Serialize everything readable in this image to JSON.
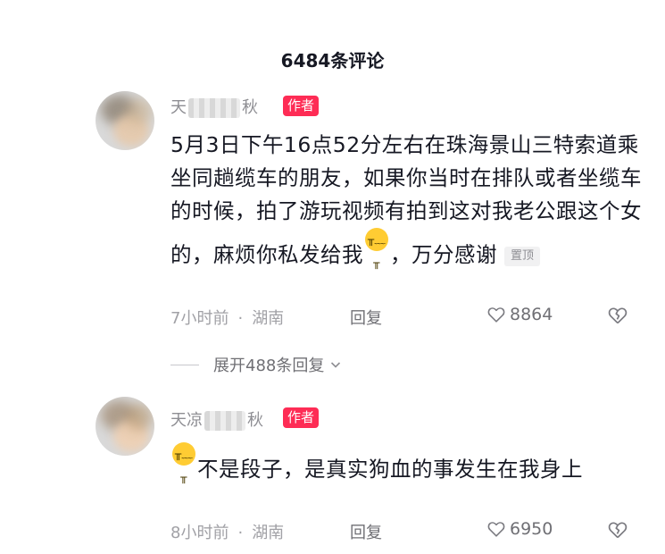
{
  "header": {
    "title": "6484条评论"
  },
  "comments": [
    {
      "username_visible": "天",
      "username_tail": "秋",
      "author_tag": "作者",
      "text_before_emoji": "5月3日下午16点52分左右在珠海景山三特索道乘坐同趟缆车的朋友，如果你当时在排队或者坐缆车的时候，拍了游玩视频有拍到这对我老公跟这个女的，麻烦你私发给我",
      "text_after_emoji": "，万分感谢",
      "pin_tag": "置顶",
      "time": "7小时前",
      "location": "湖南",
      "reply": "回复",
      "likes": "8864"
    },
    {
      "username_visible": "天凉",
      "username_tail": "秋",
      "author_tag": "作者",
      "text_before_emoji": "",
      "text_after_emoji": "不是段子，是真实狗血的事发生在我身上",
      "time": "8小时前",
      "location": "湖南",
      "reply": "回复",
      "likes": "6950"
    }
  ],
  "expand_replies": "展开488条回复",
  "separator": "·",
  "icons": {
    "emoji": "crying-face-icon",
    "like": "heart-outline-icon",
    "dislike": "broken-heart-icon",
    "expand": "chevron-down-icon"
  },
  "colors": {
    "author_tag": "#fe2c55",
    "meta_text": "#a1a1a6"
  }
}
